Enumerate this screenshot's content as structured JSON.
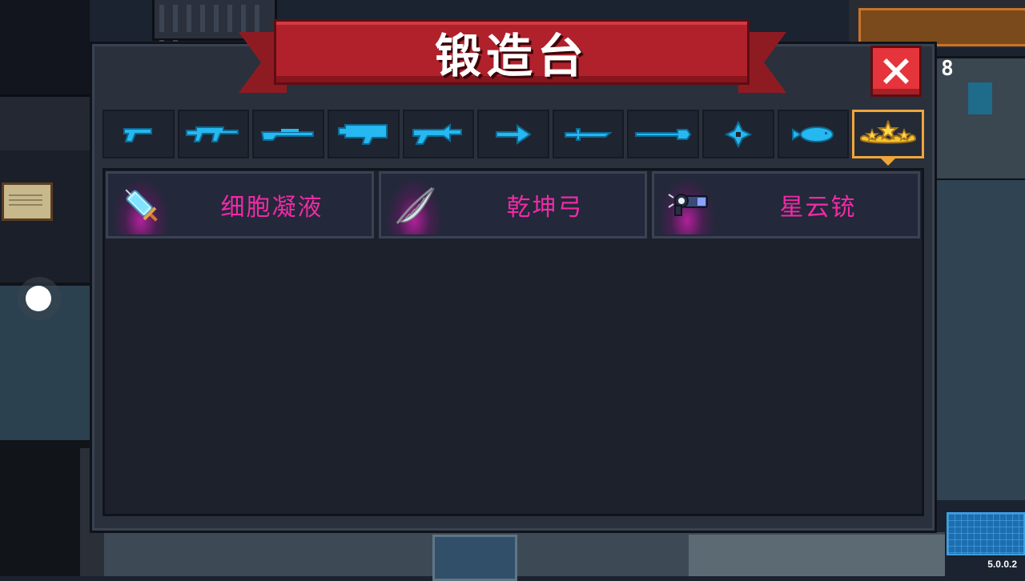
{
  "title": "锻造台",
  "close_label": "close",
  "counter": "8",
  "version": "5.0.0.2",
  "colors": {
    "banner": "#b0212b",
    "tab_icon": "#26b8f0",
    "selected_tab": "#f0a53a",
    "item_name": "#f02aa6",
    "item_glow": "#c81eaa"
  },
  "tabs": [
    {
      "icon": "pistol-icon",
      "selected": false
    },
    {
      "icon": "rifle-icon",
      "selected": false
    },
    {
      "icon": "shotgun-icon",
      "selected": false
    },
    {
      "icon": "launcher-icon",
      "selected": false
    },
    {
      "icon": "laser-gun-icon",
      "selected": false
    },
    {
      "icon": "bow-arrow-icon",
      "selected": false
    },
    {
      "icon": "sword-icon",
      "selected": false
    },
    {
      "icon": "spear-icon",
      "selected": false
    },
    {
      "icon": "shuriken-icon",
      "selected": false
    },
    {
      "icon": "fish-icon",
      "selected": false
    },
    {
      "icon": "crown-stars-icon",
      "selected": true
    }
  ],
  "items": [
    {
      "name": "细胞凝液",
      "icon": "syringe-icon"
    },
    {
      "name": "乾坤弓",
      "icon": "feather-bow-icon"
    },
    {
      "name": "星云铳",
      "icon": "nebula-gun-icon"
    }
  ]
}
